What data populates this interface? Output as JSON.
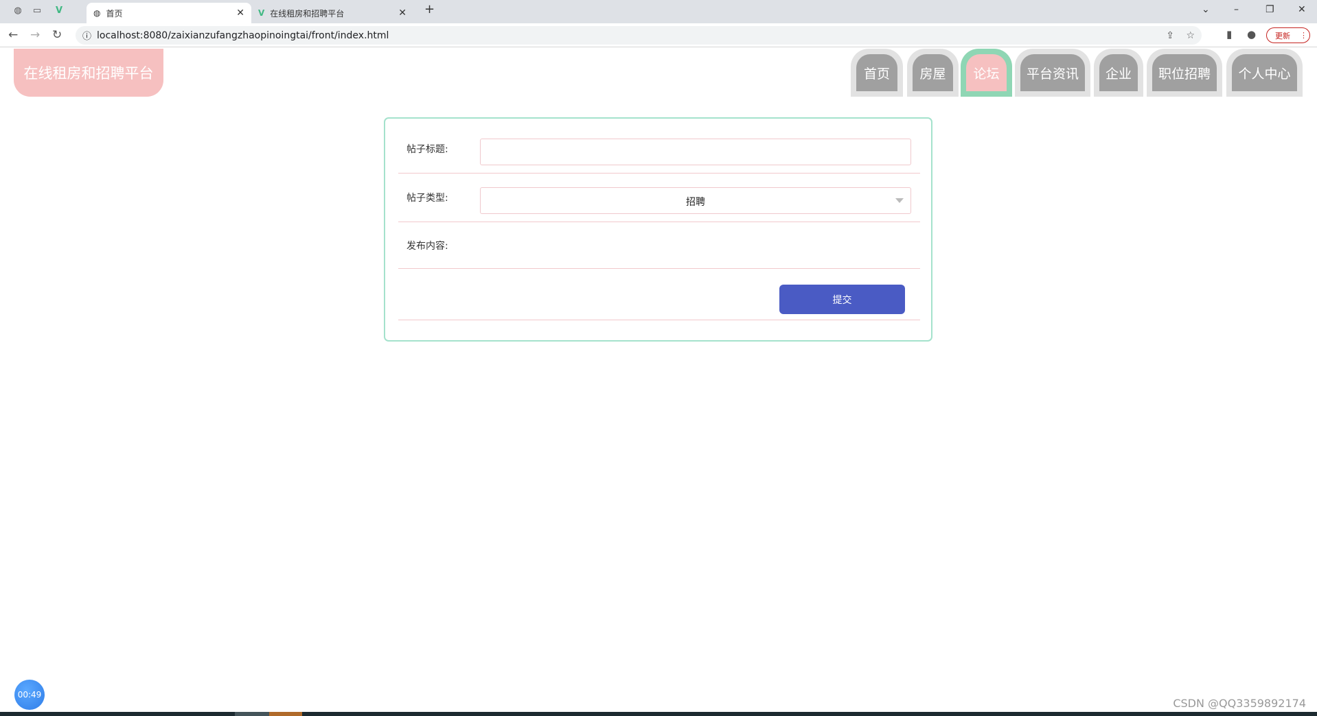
{
  "browser": {
    "tabs": [
      {
        "title": "首页",
        "active": true
      },
      {
        "title": "在线租房和招聘平台",
        "active": false
      }
    ],
    "url": "localhost:8080/zaixianzufangzhaopinoingtai/front/index.html",
    "update_label": "更新"
  },
  "header": {
    "logo": "在线租房和招聘平台",
    "nav": [
      {
        "label": "首页",
        "active": false
      },
      {
        "label": "房屋",
        "active": false
      },
      {
        "label": "论坛",
        "active": true
      },
      {
        "label": "平台资讯",
        "active": false
      },
      {
        "label": "企业",
        "active": false
      },
      {
        "label": "职位招聘",
        "active": false
      },
      {
        "label": "个人中心",
        "active": false
      }
    ]
  },
  "form": {
    "title_label": "帖子标题:",
    "title_value": "",
    "type_label": "帖子类型:",
    "type_value": "招聘",
    "content_label": "发布内容:",
    "submit_label": "提交"
  },
  "overlay": {
    "timer": "00:49",
    "watermark": "CSDN @QQ3359892174"
  },
  "colors": {
    "accent": "#4a5bc4",
    "logo_bg": "#f6c0c0",
    "nav_active_ring": "#8fd6b4",
    "card_border": "#a4e2cc"
  }
}
